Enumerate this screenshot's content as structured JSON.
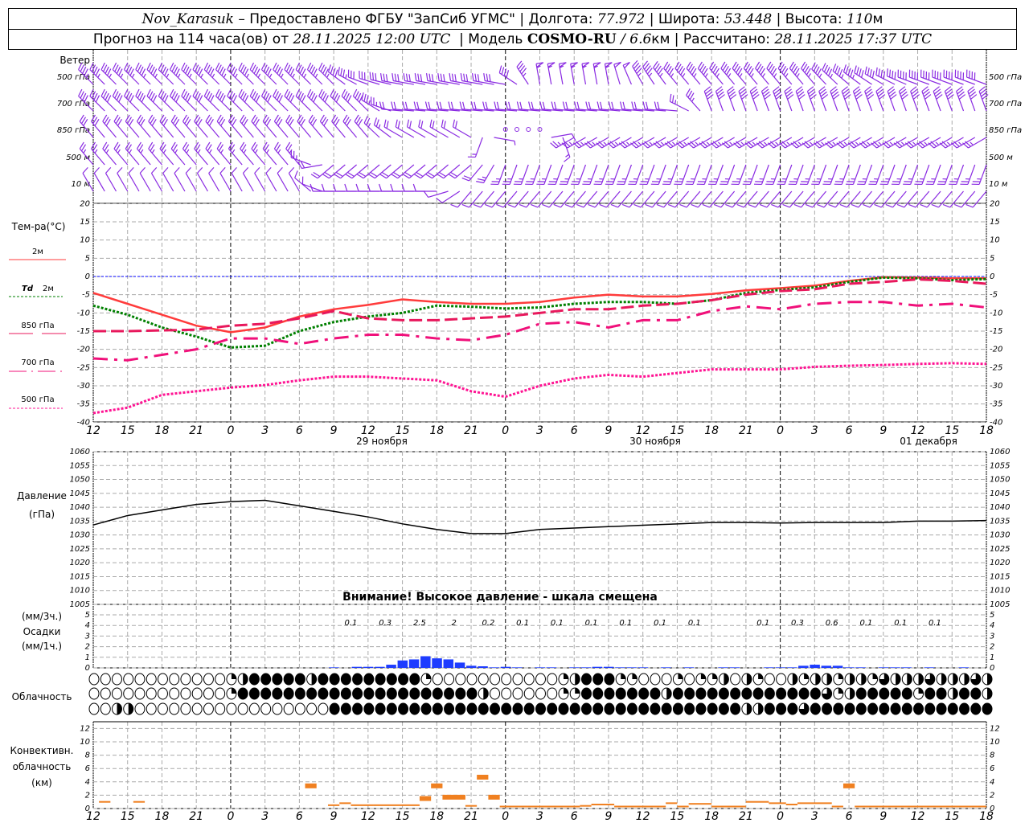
{
  "header": {
    "station": "Nov_Karasuk",
    "provided": " – Предоставлено ФГБУ \"ЗапСиб УГМС\" | Долгота: ",
    "lon": "77.972",
    "lat_label": " | Широта: ",
    "lat": "53.448",
    "alt_label": " | Высота: ",
    "alt": "110",
    "alt_unit": "м",
    "forecast_label": "Прогноз на 114 часа(ов) от ",
    "forecast_time": "28.11.2025 12:00 UTC",
    "model_label": "  | Модель ",
    "model": "COSMO-RU",
    "model_res": " / 6.6",
    "model_res_unit": "км",
    "calc_label": " | Рассчитано: ",
    "calc_time": "28.11.2025 17:37 UTC"
  },
  "labels": {
    "wind": "Ветер",
    "levels": [
      "500 гПа",
      "700 гПа",
      "850 гПа",
      "500 м",
      "10  м"
    ],
    "temp": "Тем-ра(°C)",
    "t2m": "2м",
    "td": "Td",
    "td2m": "2м",
    "t850": "850 гПа",
    "t700": "700 гПа",
    "t500": "500 гПа",
    "pressure": "Давление",
    "pressure_unit": "(гПа)",
    "warning": "Внимание! Высокое давление - шкала смещена",
    "precip3": "(мм/3ч.)",
    "precip": "Осадки",
    "precip1": "(мм/1ч.)",
    "cloud": "Облачность",
    "conv1": "Конвективн.",
    "conv2": "облачность",
    "conv3": "(км)",
    "days": [
      "29 ноября",
      "30 ноября",
      "01 декабря"
    ]
  },
  "colors": {
    "wind": "#8a2be2",
    "t2m": "#ff3b3b",
    "td": "#008000",
    "t850": "#e8185c",
    "t700": "#f0107a",
    "t500": "#ff1493",
    "zero_line": "#0000ff",
    "pressure": "#000000",
    "precip": "#1e3cff",
    "conv": "#f08020"
  },
  "chart_data": {
    "type": "line",
    "x_hours_label_sequence": [
      "12",
      "15",
      "18",
      "21",
      "0",
      "3",
      "6",
      "9",
      "12",
      "15",
      "18",
      "21",
      "0",
      "3",
      "6",
      "9",
      "12",
      "15",
      "18",
      "21",
      "0",
      "3",
      "6",
      "9",
      "12",
      "15",
      "18"
    ],
    "x_hours_from_start": [
      0,
      3,
      6,
      9,
      12,
      15,
      18,
      21,
      24,
      27,
      30,
      33,
      36,
      39,
      42,
      45,
      48,
      51,
      54,
      57,
      60,
      63,
      66,
      69,
      72,
      75,
      78
    ],
    "temperature": {
      "ylim": [
        -40,
        20
      ],
      "ticks": [
        20,
        15,
        10,
        5,
        0,
        -5,
        -10,
        -15,
        -20,
        -25,
        -30,
        -35,
        -40
      ],
      "series": [
        {
          "name": "2м",
          "style": "solid",
          "values": [
            -4.5,
            -7.5,
            -10.5,
            -13.5,
            -15.3,
            -14,
            -11,
            -9,
            -7.8,
            -6.3,
            -7,
            -7.5,
            -7.5,
            -7,
            -5.8,
            -5,
            -5.5,
            -5.5,
            -4.8,
            -3.8,
            -3.2,
            -2.5,
            -1.2,
            -0.2,
            -0.3,
            -0.5,
            -0.5
          ]
        },
        {
          "name": "Td 2м",
          "style": "dotted",
          "values": [
            -8,
            -10.5,
            -14,
            -16.5,
            -19.5,
            -19,
            -15,
            -12.5,
            -11,
            -10,
            -8,
            -8.3,
            -8.8,
            -8.5,
            -7.5,
            -7,
            -7,
            -7.5,
            -6.5,
            -4.5,
            -3.7,
            -3,
            -1.5,
            -0.3,
            -0.5,
            -1,
            -0.7
          ]
        },
        {
          "name": "850 гПа",
          "style": "dashed",
          "values": [
            -15,
            -15,
            -14.8,
            -14.6,
            -13.5,
            -13,
            -11.5,
            -9.5,
            -11.5,
            -12,
            -12,
            -11.5,
            -11,
            -10,
            -9,
            -9,
            -8,
            -7.5,
            -6.5,
            -5,
            -4,
            -3.5,
            -2,
            -1.5,
            -0.8,
            -1.2,
            -2
          ]
        },
        {
          "name": "700 гПа",
          "style": "dashdot",
          "values": [
            -22.5,
            -23,
            -21.5,
            -20,
            -17,
            -17,
            -18.5,
            -17,
            -16,
            -16,
            -17,
            -17.5,
            -16,
            -13,
            -12.5,
            -14,
            -12,
            -12,
            -9.5,
            -8.2,
            -9,
            -7.5,
            -7,
            -7,
            -8,
            -7.5,
            -8.5
          ]
        },
        {
          "name": "500 гПа",
          "style": "dotted",
          "values": [
            -37.5,
            -36,
            -32.5,
            -31.5,
            -30.5,
            -29.8,
            -28.5,
            -27.5,
            -27.5,
            -28,
            -28.5,
            -31.5,
            -33,
            -30,
            -28,
            -27,
            -27.5,
            -26.5,
            -25.5,
            -25.5,
            -25.5,
            -24.8,
            -24.5,
            -24.3,
            -24,
            -23.8,
            -24
          ]
        }
      ]
    },
    "pressure": {
      "ylim": [
        1005,
        1060
      ],
      "ticks": [
        1060,
        1055,
        1050,
        1045,
        1040,
        1035,
        1030,
        1025,
        1020,
        1015,
        1010,
        1005
      ],
      "values": [
        1033.6,
        1037,
        1039,
        1041,
        1042,
        1042.5,
        1040.5,
        1038.5,
        1036.5,
        1034,
        1032,
        1030.5,
        1030.5,
        1032,
        1032.5,
        1033,
        1033.5,
        1034,
        1034.5,
        1034.5,
        1034.3,
        1034.5,
        1034.5,
        1034.5,
        1035,
        1035,
        1035.2
      ]
    },
    "precipitation": {
      "ylim": [
        0,
        5
      ],
      "ticks": [
        0,
        1,
        2,
        3,
        4,
        5
      ],
      "hourly_mm": [
        0,
        0,
        0,
        0,
        0,
        0,
        0,
        0,
        0,
        0,
        0,
        0,
        0,
        0,
        0,
        0,
        0,
        0,
        0,
        0,
        0,
        0.05,
        0,
        0.1,
        0.1,
        0.1,
        0.3,
        0.7,
        0.8,
        1.1,
        0.9,
        0.8,
        0.5,
        0.2,
        0.15,
        0.05,
        0.1,
        0.05,
        0,
        0.05,
        0.05,
        0,
        0.05,
        0.05,
        0.1,
        0.1,
        0.05,
        0.05,
        0.05,
        0,
        0.05,
        0,
        0.05,
        0,
        0,
        0.05,
        0.05,
        0,
        0,
        0.05,
        0.05,
        0.05,
        0.2,
        0.3,
        0.2,
        0.2,
        0.05,
        0.05,
        0,
        0.05,
        0.05,
        0.05,
        0,
        0.05,
        0,
        0,
        0.05,
        0,
        0
      ],
      "sum_3h": [
        {
          "start_hour": 21,
          "label": "0.1"
        },
        {
          "start_hour": 24,
          "label": "0.3"
        },
        {
          "start_hour": 27,
          "label": "2.5"
        },
        {
          "start_hour": 30,
          "label": "2"
        },
        {
          "start_hour": 33,
          "label": "0.2"
        },
        {
          "start_hour": 36,
          "label": "0.1"
        },
        {
          "start_hour": 39,
          "label": "0.1"
        },
        {
          "start_hour": 42,
          "label": "0.1"
        },
        {
          "start_hour": 45,
          "label": "0.1"
        },
        {
          "start_hour": 48,
          "label": "0.1"
        },
        {
          "start_hour": 51,
          "label": "0.1"
        },
        {
          "start_hour": 57,
          "label": "0.1"
        },
        {
          "start_hour": 60,
          "label": "0.3"
        },
        {
          "start_hour": 63,
          "label": "0.6"
        },
        {
          "start_hour": 66,
          "label": "0.1"
        },
        {
          "start_hour": 69,
          "label": "0.1"
        },
        {
          "start_hour": 72,
          "label": "0.1"
        }
      ]
    },
    "cloud_cover_fraction": {
      "rows": [
        [
          0,
          0,
          0,
          0,
          0,
          0,
          0,
          0,
          0,
          0,
          0,
          0,
          0.25,
          0.5,
          1,
          1,
          1,
          1,
          1,
          0.5,
          1,
          1,
          1,
          1,
          1,
          1,
          1,
          1,
          1,
          0.25,
          0,
          0,
          0,
          0,
          0,
          0,
          0,
          0,
          0,
          0,
          0,
          0.25,
          0.5,
          1,
          1,
          1,
          0.25,
          0.25,
          0,
          0,
          0,
          0.25,
          0,
          0.25,
          0.25,
          0.5,
          0,
          0.5,
          0.25,
          0,
          0,
          0.5,
          0.25,
          0.5,
          0.5,
          0.25,
          0.5,
          0.5,
          0.25,
          0.75,
          0.5,
          0.5,
          0.5,
          0.75,
          0.5,
          0.5,
          0.5,
          0.75,
          0.5
        ],
        [
          0,
          0,
          0,
          0,
          0,
          0,
          0,
          0,
          0,
          0,
          0,
          0,
          0.25,
          1,
          1,
          1,
          1,
          1,
          1,
          1,
          1,
          1,
          1,
          1,
          1,
          1,
          1,
          1,
          1,
          1,
          1,
          1,
          1,
          1,
          0.5,
          0,
          0,
          0,
          0,
          0,
          0,
          0.25,
          0.25,
          1,
          1,
          1,
          1,
          1,
          1,
          1,
          0.5,
          1,
          1,
          1,
          1,
          1,
          1,
          1,
          1,
          1,
          1,
          1,
          1,
          1,
          0.75,
          0.25,
          0.5,
          1,
          1,
          1,
          1,
          1,
          0.25,
          1,
          1,
          0.5,
          1,
          1,
          0.5
        ],
        [
          0,
          0,
          0.5,
          0.5,
          0,
          0,
          0,
          0,
          0,
          0,
          0,
          0,
          0,
          0,
          0,
          0,
          0,
          0,
          0,
          0,
          0,
          1,
          1,
          1,
          1,
          1,
          1,
          1,
          1,
          1,
          1,
          1,
          1,
          1,
          1,
          1,
          1,
          1,
          1,
          1,
          1,
          1,
          1,
          1,
          1,
          1,
          1,
          1,
          1,
          1,
          1,
          1,
          1,
          1,
          1,
          1,
          1,
          0.5,
          0.5,
          1,
          1,
          1,
          0.75,
          1,
          1,
          1,
          1,
          1,
          1,
          1,
          1,
          1,
          1,
          1,
          1,
          1,
          1,
          1,
          1
        ]
      ]
    },
    "convective_cloud_km": {
      "ylim": [
        0,
        13
      ],
      "ticks": [
        0,
        2,
        4,
        6,
        8,
        10,
        12
      ],
      "segments": [
        [
          0.5,
          1.5,
          1.0
        ],
        [
          3.5,
          4.5,
          1.0
        ],
        [
          18.5,
          19.5,
          3.4
        ],
        [
          20.5,
          21.5,
          0.5
        ],
        [
          21.5,
          22.5,
          0.8
        ],
        [
          22.5,
          24.5,
          0.5
        ],
        [
          24.5,
          28.5,
          0.5
        ],
        [
          28.5,
          29.5,
          1.5
        ],
        [
          29.5,
          30.5,
          3.4
        ],
        [
          30.5,
          32.5,
          1.7
        ],
        [
          32.5,
          33.5,
          0.4
        ],
        [
          33.5,
          34.5,
          4.7
        ],
        [
          34.5,
          35.5,
          1.7
        ],
        [
          35.5,
          42.5,
          0.3
        ],
        [
          42.5,
          43.5,
          0.4
        ],
        [
          43.5,
          45.5,
          0.6
        ],
        [
          45.5,
          50,
          0.3
        ],
        [
          50,
          51,
          0.8
        ],
        [
          51,
          52,
          0.3
        ],
        [
          52,
          54,
          0.7
        ],
        [
          54,
          57,
          0.3
        ],
        [
          57,
          59,
          1.0
        ],
        [
          59,
          60.5,
          0.8
        ],
        [
          60.5,
          61.5,
          0.6
        ],
        [
          61.5,
          64.5,
          0.8
        ],
        [
          64.5,
          65.5,
          0.3
        ],
        [
          65.5,
          66.5,
          3.4
        ],
        [
          66.5,
          78,
          0.3
        ]
      ]
    },
    "wind": {
      "levels": [
        {
          "name": "500 гПа",
          "dir": [
            315,
            315,
            315,
            315,
            315,
            315,
            315,
            315,
            290,
            280,
            280,
            280,
            280,
            350,
            350,
            350,
            330,
            320,
            320,
            320,
            320,
            320,
            310,
            300,
            290,
            290,
            290
          ],
          "speed_kt": [
            45,
            45,
            45,
            45,
            45,
            45,
            45,
            45,
            30,
            30,
            30,
            30,
            30,
            55,
            55,
            55,
            45,
            45,
            45,
            45,
            45,
            45,
            45,
            40,
            40,
            40,
            40
          ]
        },
        {
          "name": "700 гПа",
          "dir": [
            315,
            315,
            315,
            315,
            315,
            315,
            315,
            315,
            315,
            275,
            275,
            275,
            275,
            275,
            275,
            275,
            275,
            275,
            340,
            340,
            340,
            340,
            340,
            340,
            340,
            340,
            340
          ],
          "speed_kt": [
            40,
            40,
            40,
            40,
            40,
            40,
            40,
            40,
            40,
            20,
            20,
            20,
            20,
            20,
            20,
            20,
            20,
            20,
            40,
            40,
            40,
            40,
            40,
            40,
            40,
            40,
            40
          ]
        },
        {
          "name": "850 гПа",
          "dir": [
            320,
            320,
            320,
            320,
            320,
            320,
            320,
            320,
            320,
            300,
            300,
            300,
            0,
            0,
            240,
            240,
            240,
            240,
            240,
            240,
            240,
            240,
            240,
            240,
            240,
            240,
            240
          ],
          "speed_kt": [
            30,
            30,
            30,
            30,
            30,
            30,
            30,
            30,
            30,
            20,
            20,
            20,
            0,
            0,
            25,
            25,
            25,
            25,
            25,
            25,
            25,
            25,
            25,
            25,
            25,
            25,
            25
          ]
        },
        {
          "name": "500 м",
          "dir": [
            320,
            320,
            320,
            320,
            320,
            320,
            320,
            230,
            230,
            230,
            230,
            230,
            200,
            200,
            200,
            200,
            200,
            200,
            200,
            200,
            200,
            200,
            200,
            200,
            200,
            200,
            200
          ],
          "speed_kt": [
            25,
            25,
            25,
            25,
            25,
            25,
            25,
            20,
            20,
            20,
            20,
            20,
            25,
            25,
            25,
            25,
            25,
            25,
            25,
            25,
            25,
            25,
            25,
            25,
            25,
            25,
            25
          ]
        },
        {
          "name": "10  м",
          "dir": [
            330,
            330,
            330,
            330,
            330,
            330,
            330,
            270,
            270,
            270,
            270,
            220,
            220,
            220,
            220,
            220,
            220,
            220,
            220,
            220,
            220,
            220,
            220,
            220,
            220,
            220,
            220
          ],
          "speed_kt": [
            10,
            10,
            10,
            10,
            10,
            10,
            10,
            10,
            10,
            10,
            10,
            12,
            12,
            12,
            12,
            12,
            12,
            12,
            12,
            12,
            12,
            12,
            12,
            12,
            12,
            12,
            12
          ]
        }
      ]
    }
  }
}
